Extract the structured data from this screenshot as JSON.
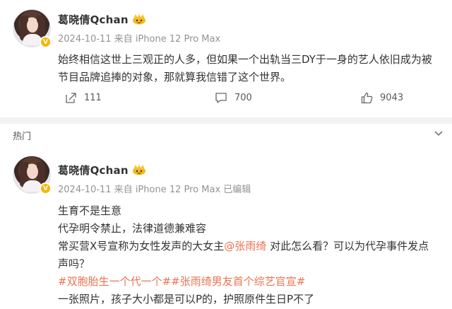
{
  "post1": {
    "username": "葛晓倩Qchan",
    "meta": "2024-10-11  来自 iPhone 12 Pro Max",
    "content_lines": [
      "始终相信这世上三观正的人多，但如果一个出轨当三DY于一身的艺人依旧成为被",
      "节目品牌追捧的对象，那就算我信错了这个世界。"
    ],
    "actions": {
      "share_count": "111",
      "comment_count": "700",
      "like_count": "9043"
    }
  },
  "hot_section": {
    "title": "热门"
  },
  "post2": {
    "username": "葛晓倩Qchan",
    "meta": "2024-10-11  来自 iPhone 12 Pro Max 已编辑",
    "line1": "生育不是生意",
    "line2": "代孕明令禁止，法律道德兼难容",
    "line3_pre": "常买营X号宣称为女性发声的大女主",
    "line3_mention": "@张雨绮",
    "line3_post": " 对此怎么看？可以为代孕事件发点",
    "line4": "声吗？",
    "line5_tags": "#双胞胎生一个代一个##张雨绮男友首个综艺官宣#",
    "line6": "一张照片，孩子大小都是可以P的，护照原件生日P不了"
  },
  "colors": {
    "accent": "#eb7350",
    "vip_gold": "#f7b500",
    "meta_gray": "#939393"
  },
  "icons": [
    "verified-badge-icon",
    "crown-icon",
    "share-icon",
    "comment-icon",
    "like-icon",
    "chevron-down-icon"
  ]
}
